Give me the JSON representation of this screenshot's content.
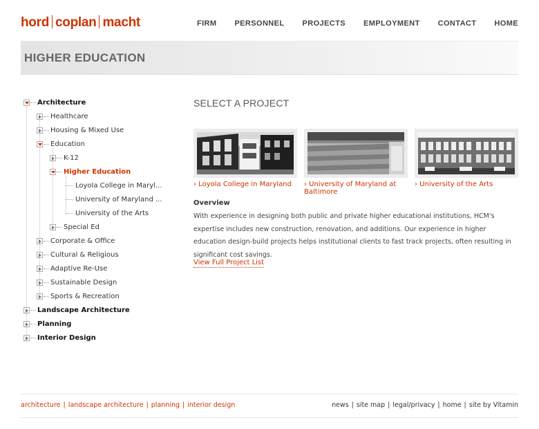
{
  "logo": {
    "part1": "hord",
    "part2": "coplan",
    "part3": "macht"
  },
  "topnav": [
    "FIRM",
    "PERSONNEL",
    "PROJECTS",
    "EMPLOYMENT",
    "CONTACT",
    "HOME"
  ],
  "banner": {
    "title": "HIGHER EDUCATION"
  },
  "tree": {
    "architecture": "Architecture",
    "healthcare": "Healthcare",
    "housing": "Housing & Mixed Use",
    "education": "Education",
    "k12": "K-12",
    "higher_ed": "Higher Education",
    "loyola": "Loyola College in Maryl...",
    "umd": "University of Maryland ...",
    "uarts": "University of the Arts",
    "special_ed": "Special Ed",
    "corporate": "Corporate & Office",
    "cultural": "Cultural & Religious",
    "adaptive": "Adaptive Re-Use",
    "sustainable": "Sustainable Design",
    "sports": "Sports & Recreation",
    "landscape": "Landscape Architecture",
    "planning": "Planning",
    "interior": "Interior Design"
  },
  "main": {
    "title": "SELECT A PROJECT",
    "projects": [
      {
        "label": "› Loyola College in Maryland"
      },
      {
        "label": "› University of Maryland at Baltimore"
      },
      {
        "label": "› University of the Arts"
      }
    ],
    "overview_heading": "Overview",
    "overview_text": "With experience in designing both public and private higher educational institutions, HCM's expertise includes new construction, renovation, and additions. Our experience in higher education design-build projects helps institutional clients to fast track projects, often resulting in significant cost savings.",
    "full_list": "View Full Project List"
  },
  "footer": {
    "left": [
      "architecture",
      "landscape architecture",
      "planning",
      "interior design"
    ],
    "right": [
      "news",
      "site map",
      "legal/privacy",
      "home",
      "site by Vitamin"
    ]
  },
  "colors": {
    "accent": "#cc3300",
    "text": "#333333"
  }
}
